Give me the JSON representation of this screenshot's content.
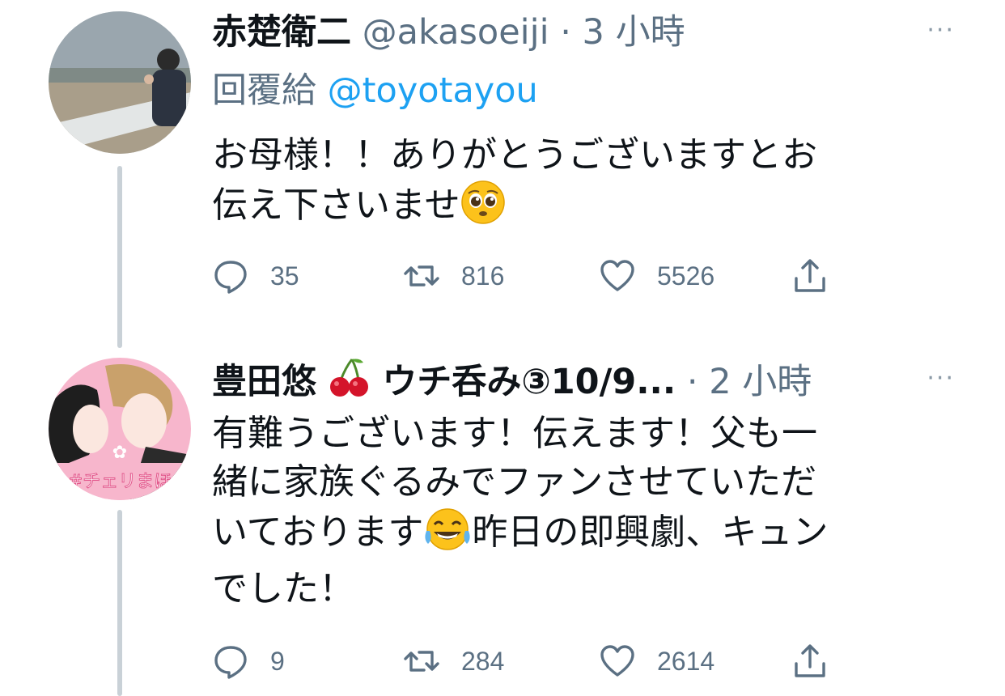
{
  "tweets": [
    {
      "name": "赤楚衛二",
      "handle": "@akasoeiji",
      "dot": "·",
      "time": "3 小時",
      "more": "···",
      "reply_prefix": "回覆給",
      "reply_mention": "@toyotayou",
      "body_line1": "お母様！！ありがとうございますとお",
      "body_line2": "伝え下さいませ",
      "emoji_icon": "pleading-face-emoji",
      "actions": {
        "replies": "35",
        "retweets": "816",
        "likes": "5526"
      }
    },
    {
      "name": "豊田悠",
      "name_suffix": "ウチ呑み③10/9...",
      "name_emoji_icon": "cherries-emoji",
      "dot": "·",
      "time": "2 小時",
      "more": "···",
      "body_line1": "有難うございます！伝えます！父も一",
      "body_line2": "緒に家族ぐるみでファンさせていただ",
      "body_line3a": "いております",
      "body_line3b": "昨日の即興劇、キュン",
      "body_line4": "でした！",
      "emoji_icon": "tears-of-joy-emoji",
      "avatar_badge": "#チェリまほ",
      "actions": {
        "replies": "9",
        "retweets": "284",
        "likes": "2614"
      }
    }
  ],
  "colors": {
    "accent": "#1da1f2",
    "muted": "#5b7083",
    "thread": "#c9d1d7"
  }
}
